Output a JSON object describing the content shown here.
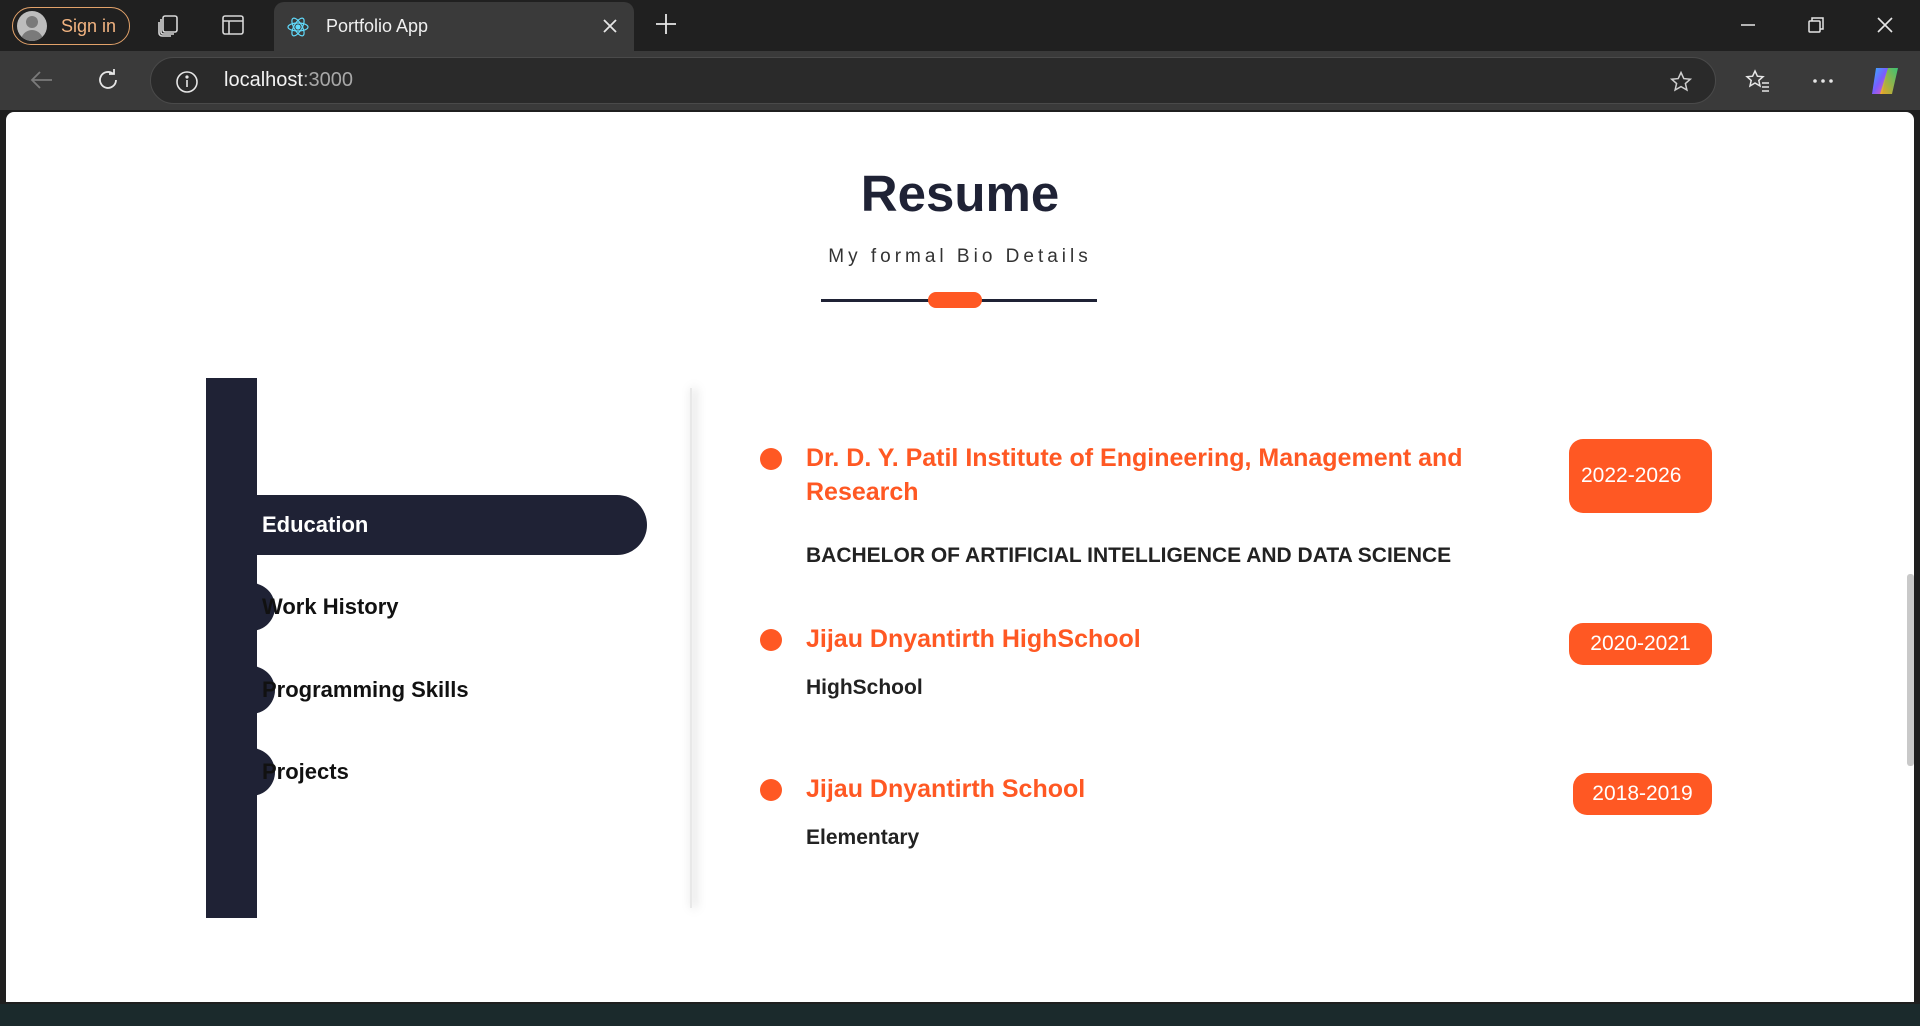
{
  "browser": {
    "sign_in_label": "Sign in",
    "tab_title": "Portfolio App",
    "url_host": "localhost",
    "url_port": ":3000"
  },
  "resume": {
    "title": "Resume",
    "subtitle": "My formal Bio Details",
    "menu": [
      {
        "label": "Education",
        "active": true
      },
      {
        "label": "Work History",
        "active": false
      },
      {
        "label": "Programming Skills",
        "active": false
      },
      {
        "label": "Projects",
        "active": false
      }
    ],
    "entries": [
      {
        "heading": "Dr. D. Y. Patil Institute of Engineering, Management and Research",
        "subheading": "BACHELOR OF ARTIFICIAL INTELLIGENCE AND DATA SCIENCE",
        "dates": "2022-2026"
      },
      {
        "heading": "Jijau Dnyantirth HighSchool",
        "subheading": "HighSchool",
        "dates": "2020-2021"
      },
      {
        "heading": "Jijau Dnyantirth School",
        "subheading": "Elementary",
        "dates": "2018-2019"
      }
    ]
  },
  "colors": {
    "accent": "#ff5823",
    "dark": "#1f2235"
  }
}
